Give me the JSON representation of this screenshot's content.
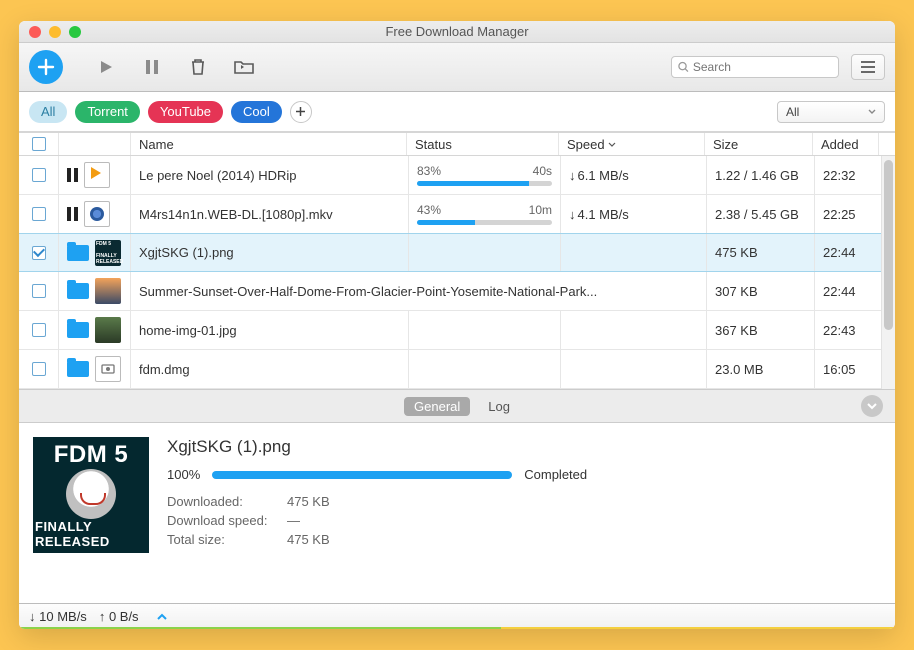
{
  "window": {
    "title": "Free Download Manager"
  },
  "toolbar": {
    "search_placeholder": "Search"
  },
  "tags": {
    "all": "All",
    "torrent": "Torrent",
    "youtube": "YouTube",
    "cool": "Cool"
  },
  "filter": {
    "selected": "All"
  },
  "columns": {
    "name": "Name",
    "status": "Status",
    "speed": "Speed",
    "size": "Size",
    "added": "Added"
  },
  "rows": [
    {
      "name": "Le pere Noel (2014) HDRip",
      "percent": "83%",
      "eta": "40s",
      "speed": "6.1 MB/s",
      "size": "1.22 / 1.46 GB",
      "added": "22:32",
      "pval": 83
    },
    {
      "name": "M4rs14n1n.WEB-DL.[1080p].mkv",
      "percent": "43%",
      "eta": "10m",
      "speed": "4.1 MB/s",
      "size": "2.38 / 5.45 GB",
      "added": "22:25",
      "pval": 43
    },
    {
      "name": "XgjtSKG (1).png",
      "size": "475 KB",
      "added": "22:44"
    },
    {
      "name": "Summer-Sunset-Over-Half-Dome-From-Glacier-Point-Yosemite-National-Park...",
      "size": "307 KB",
      "added": "22:44"
    },
    {
      "name": "home-img-01.jpg",
      "size": "367 KB",
      "added": "22:43"
    },
    {
      "name": "fdm.dmg",
      "size": "23.0 MB",
      "added": "16:05"
    }
  ],
  "detail": {
    "tabs": {
      "general": "General",
      "log": "Log"
    },
    "name": "XgjtSKG (1).png",
    "percent": "100%",
    "status": "Completed",
    "labels": {
      "downloaded": "Downloaded:",
      "speed": "Download speed:",
      "total": "Total size:"
    },
    "downloaded": "475 KB",
    "speed": "—",
    "total": "475 KB",
    "thumb": {
      "top": "FDM 5",
      "bottom": "FINALLY RELEASED"
    }
  },
  "statusbar": {
    "down": "10 MB/s",
    "up": "0 B/s"
  }
}
